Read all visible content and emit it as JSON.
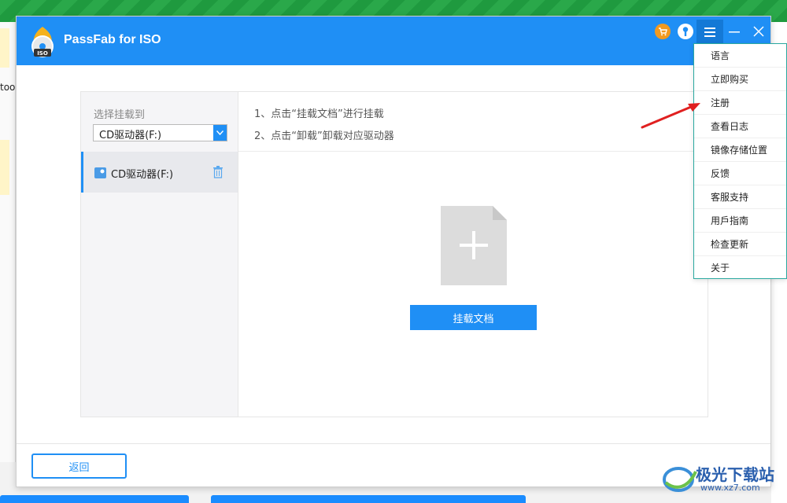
{
  "desktop": {
    "left_text": "too"
  },
  "window": {
    "title": "PassFab for ISO",
    "logo_badge": "ISO"
  },
  "titlebar_icons": [
    "cart-icon",
    "help-icon",
    "menu-icon",
    "minimize-icon",
    "close-icon"
  ],
  "sidebar": {
    "label": "选择挂载到",
    "select_value": "CD驱动器(F:)",
    "drive_item": "CD驱动器(F:)"
  },
  "instructions": {
    "line1": "1、点击“挂载文档”进行挂载",
    "line2": "2、点击“卸载”卸载对应驱动器"
  },
  "main": {
    "mount_button": "挂载文档"
  },
  "footer": {
    "back_button": "返回"
  },
  "menu": {
    "items": [
      "语言",
      "立即购买",
      "注册",
      "查看日志",
      "镜像存储位置",
      "反馈",
      "客服支持",
      "用戶指南",
      "检查更新",
      "关于"
    ]
  },
  "watermark": {
    "text": "极光下载站",
    "url": "www.xz7.com"
  },
  "colors": {
    "accent": "#1f8ff5",
    "annotation": "#e02020"
  }
}
